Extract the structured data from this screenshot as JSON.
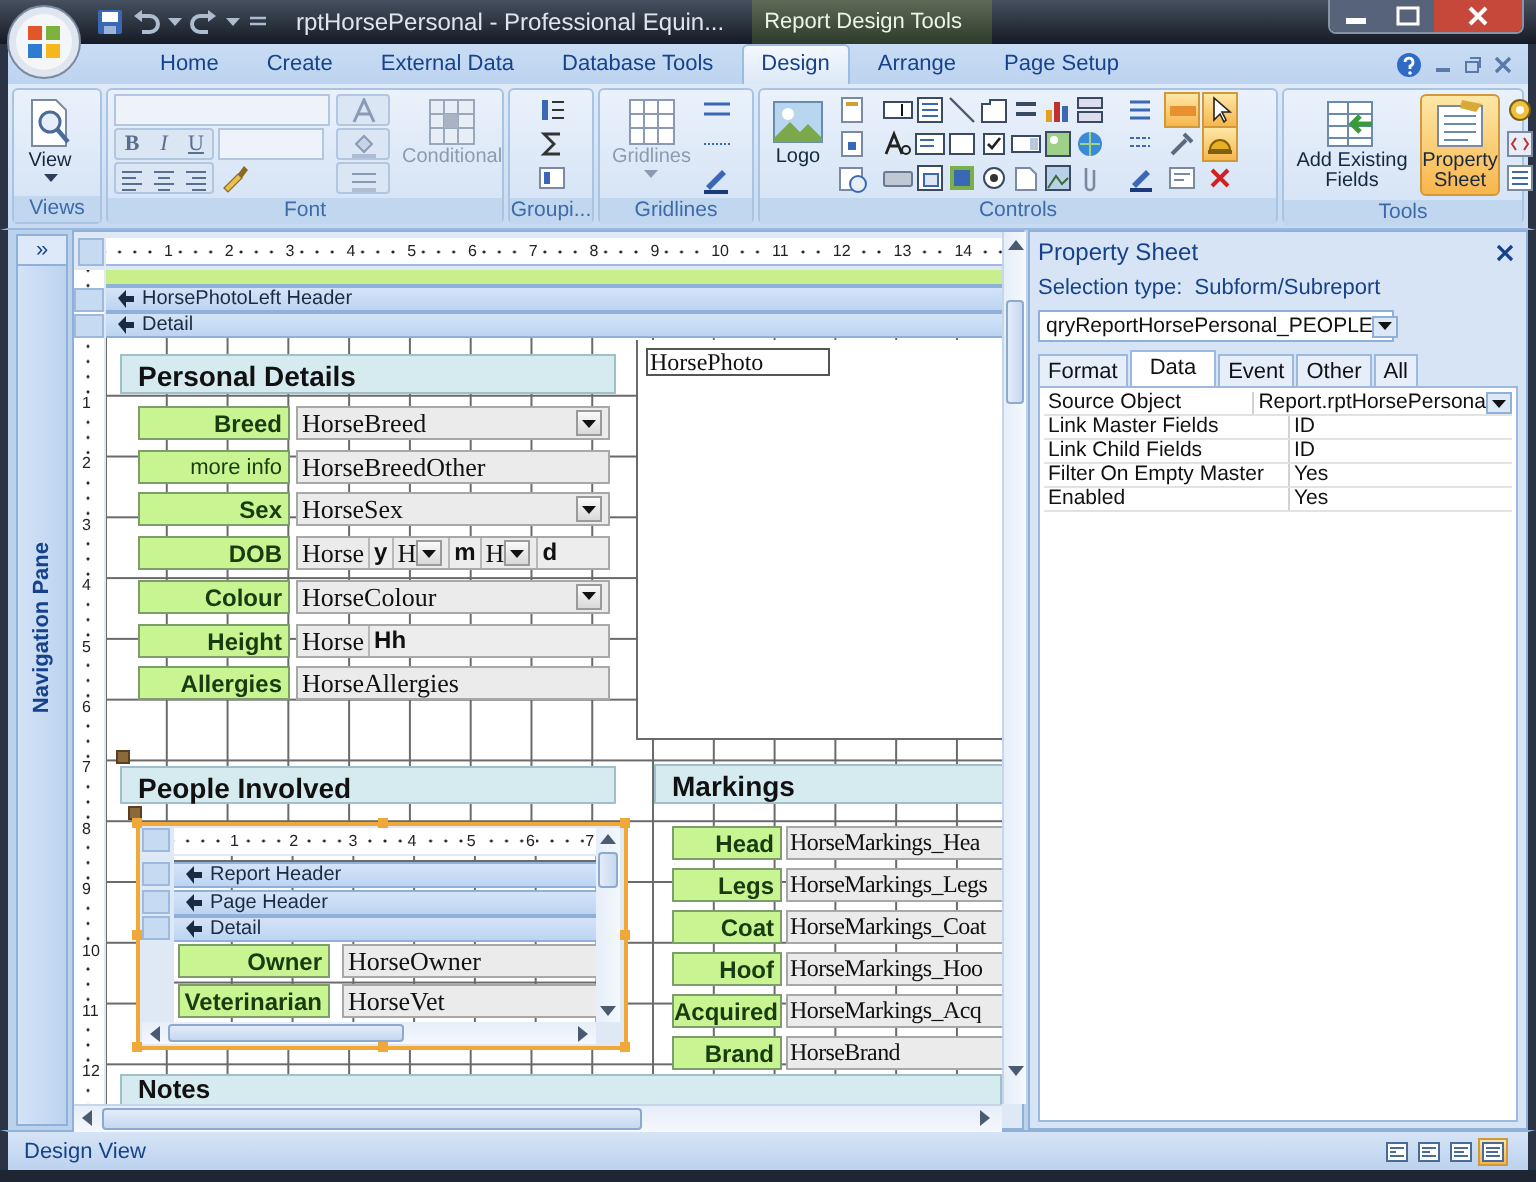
{
  "window": {
    "title": "rptHorsePersonal - Professional Equin...",
    "context_tab": "Report Design Tools"
  },
  "ribbon_tabs": [
    {
      "label": "Home",
      "selected": false
    },
    {
      "label": "Create",
      "selected": false
    },
    {
      "label": "External Data",
      "selected": false
    },
    {
      "label": "Database Tools",
      "selected": false
    },
    {
      "label": "Design",
      "selected": true
    },
    {
      "label": "Arrange",
      "selected": false
    },
    {
      "label": "Page Setup",
      "selected": false
    }
  ],
  "ribbon": {
    "views": {
      "label": "Views",
      "button": "View"
    },
    "font": {
      "label": "Font",
      "bold": "B",
      "italic": "I",
      "underline": "U",
      "conditional": "Conditional"
    },
    "grouping": {
      "label": "Groupi..."
    },
    "gridlines": {
      "label": "Gridlines",
      "button": "Gridlines"
    },
    "controls": {
      "label": "Controls",
      "logo": "Logo",
      "tool_states": [
        {
          "on": true
        },
        {
          "on": true
        },
        {
          "on": true
        }
      ]
    },
    "tools": {
      "label": "Tools",
      "buttons": [
        {
          "label": "Add Existing Fields",
          "on": false
        },
        {
          "label": "Property Sheet",
          "on": true
        }
      ]
    }
  },
  "navigation_pane": {
    "toggle": "»",
    "label": "Navigation Pane"
  },
  "design": {
    "ruler_marks": [
      "1",
      "2",
      "3",
      "4",
      "5",
      "6",
      "7",
      "8",
      "9",
      "10",
      "11",
      "12",
      "13",
      "14"
    ],
    "vertical_ruler_marks": [
      "1",
      "2",
      "3",
      "4",
      "5",
      "6",
      "7",
      "8",
      "9",
      "10",
      "11",
      "12"
    ],
    "sections": [
      "HorsePhotoLeft Header",
      "Detail"
    ],
    "personal_details": {
      "heading": "Personal Details",
      "fields": [
        {
          "label": "Breed",
          "bold": true,
          "parts": [
            {
              "kind": "combo",
              "text": "HorseBreed"
            }
          ]
        },
        {
          "label": "more info",
          "bold": false,
          "parts": [
            {
              "kind": "text",
              "text": "HorseBreedOther"
            }
          ]
        },
        {
          "label": "Sex",
          "bold": true,
          "parts": [
            {
              "kind": "combo",
              "text": "HorseSex"
            }
          ]
        },
        {
          "label": "DOB",
          "bold": true,
          "parts": [
            {
              "kind": "text",
              "text": "Horse"
            },
            {
              "kind": "label",
              "text": "y"
            },
            {
              "kind": "combo",
              "text": "H"
            },
            {
              "kind": "label",
              "text": "m"
            },
            {
              "kind": "combo",
              "text": "H"
            },
            {
              "kind": "label",
              "text": "d"
            }
          ]
        },
        {
          "label": "Colour",
          "bold": true,
          "parts": [
            {
              "kind": "combo",
              "text": "HorseColour"
            }
          ]
        },
        {
          "label": "Height",
          "bold": true,
          "parts": [
            {
              "kind": "text",
              "text": "Horse"
            },
            {
              "kind": "label",
              "text": "Hh"
            }
          ]
        },
        {
          "label": "Allergies",
          "bold": true,
          "parts": [
            {
              "kind": "text",
              "text": "HorseAllergies"
            }
          ]
        }
      ]
    },
    "photo": {
      "field": "HorsePhoto"
    },
    "people_involved": {
      "heading": "People Involved",
      "subreport": {
        "ruler_marks": [
          "1",
          "2",
          "3",
          "4",
          "5",
          "6",
          "7"
        ],
        "sections": [
          "Report Header",
          "Page Header",
          "Detail"
        ],
        "fields": [
          {
            "label": "Owner",
            "value": "HorseOwner"
          },
          {
            "label": "Veterinarian",
            "value": "HorseVet"
          }
        ]
      }
    },
    "markings": {
      "heading": "Markings",
      "fields": [
        {
          "label": "Head",
          "value": "HorseMarkings_Hea"
        },
        {
          "label": "Legs",
          "value": "HorseMarkings_Legs"
        },
        {
          "label": "Coat",
          "value": "HorseMarkings_Coat"
        },
        {
          "label": "Hoof",
          "value": "HorseMarkings_Hoo"
        },
        {
          "label": "Acquired",
          "value": "HorseMarkings_Acq"
        },
        {
          "label": "Brand",
          "value": "HorseBrand"
        }
      ]
    },
    "notes": {
      "heading": "Notes"
    }
  },
  "property_sheet": {
    "title": "Property Sheet",
    "selection_label": "Selection type:",
    "selection_type": "Subform/Subreport",
    "object": "qryReportHorsePersonal_PEOPLE",
    "tabs": [
      {
        "label": "Format",
        "selected": false
      },
      {
        "label": "Data",
        "selected": true
      },
      {
        "label": "Event",
        "selected": false
      },
      {
        "label": "Other",
        "selected": false
      },
      {
        "label": "All",
        "selected": false
      }
    ],
    "properties": [
      {
        "name": "Source Object",
        "value": "Report.rptHorsePersona",
        "kind": "dropdown"
      },
      {
        "name": "Link Master Fields",
        "value": "ID",
        "kind": "text"
      },
      {
        "name": "Link Child Fields",
        "value": "ID",
        "kind": "text"
      },
      {
        "name": "Filter On Empty Master",
        "value": "Yes",
        "kind": "text"
      },
      {
        "name": "Enabled",
        "value": "Yes",
        "kind": "text"
      }
    ]
  },
  "status_bar": {
    "text": "Design View",
    "view_buttons": [
      {
        "selected": false
      },
      {
        "selected": false
      },
      {
        "selected": false
      },
      {
        "selected": true
      }
    ]
  }
}
